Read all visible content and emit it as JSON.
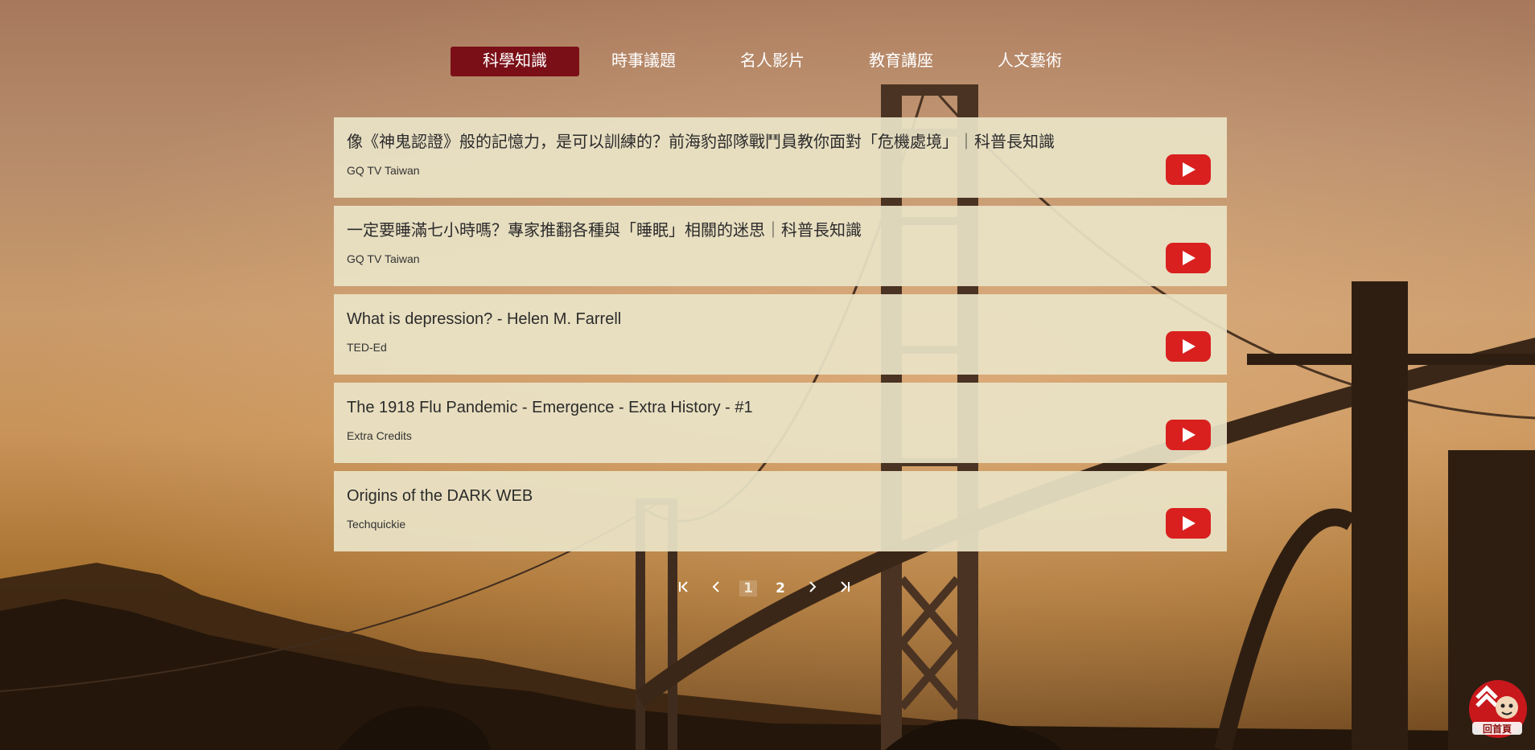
{
  "tabs": [
    {
      "label": "科學知識",
      "active": true
    },
    {
      "label": "時事議題",
      "active": false
    },
    {
      "label": "名人影片",
      "active": false
    },
    {
      "label": "教育講座",
      "active": false
    },
    {
      "label": "人文藝術",
      "active": false
    }
  ],
  "videos": [
    {
      "title": "像《神鬼認證》般的記憶力，是可以訓練的？前海豹部隊戰鬥員教你面對「危機處境」｜科普長知識",
      "channel": "GQ TV Taiwan"
    },
    {
      "title": "一定要睡滿七小時嗎？專家推翻各種與「睡眠」相關的迷思｜科普長知識",
      "channel": "GQ TV Taiwan"
    },
    {
      "title": "What is depression? - Helen M. Farrell",
      "channel": "TED-Ed"
    },
    {
      "title": "The 1918 Flu Pandemic - Emergence - Extra History - #1",
      "channel": "Extra Credits"
    },
    {
      "title": "Origins of the DARK WEB",
      "channel": "Techquickie"
    }
  ],
  "pagination": {
    "first_icon": "first-page-icon",
    "prev_icon": "prev-page-icon",
    "pages": [
      "1",
      "2"
    ],
    "current": "1",
    "next_icon": "next-page-icon",
    "last_icon": "last-page-icon"
  },
  "back_to_top": {
    "label": "回首頁",
    "icon": "back-to-top-mascot-icon"
  },
  "colors": {
    "active_tab": "#7a0f17",
    "youtube_red": "#d9201f",
    "card_bg": "#e9e3c6"
  }
}
